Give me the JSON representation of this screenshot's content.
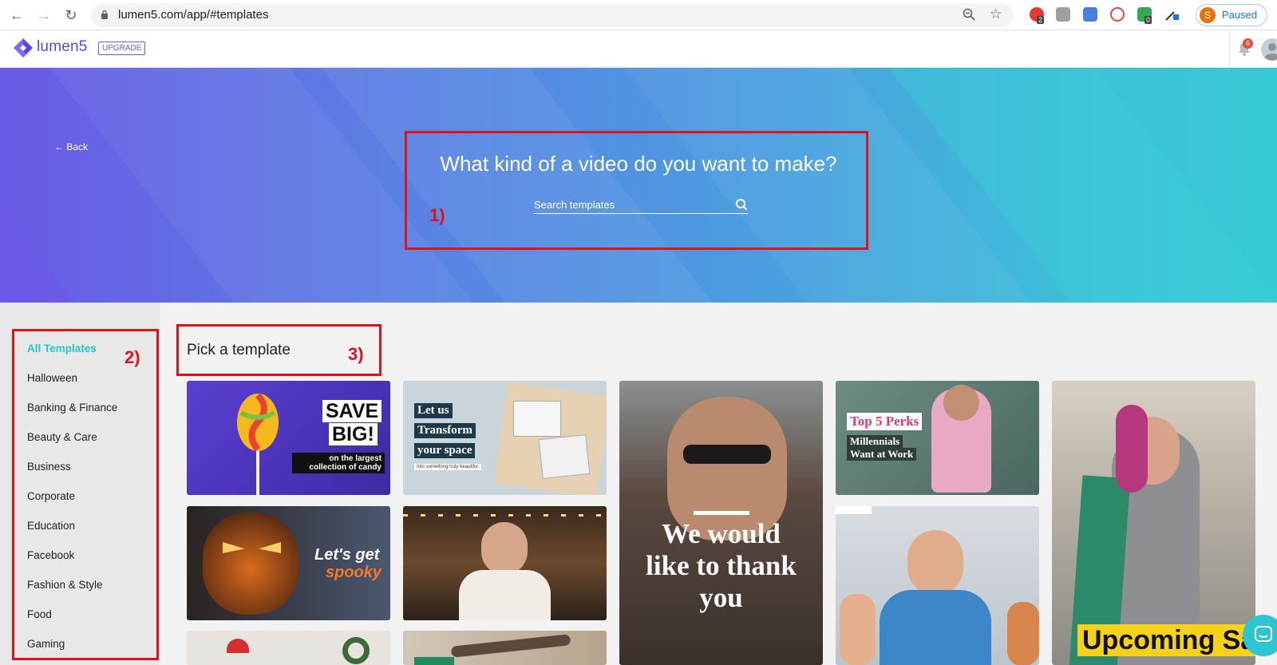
{
  "browser": {
    "url": "lumen5.com/app/#templates",
    "profile_initial": "S",
    "profile_label": "Paused",
    "ext_badges": [
      "2",
      "0"
    ]
  },
  "app": {
    "logo_text": "lumen5",
    "upgrade_label": "UPGRADE",
    "notification_count": "6"
  },
  "hero": {
    "back_label": "← Back",
    "title": "What kind of a video do you want to make?",
    "search_placeholder": "Search templates"
  },
  "annotations": [
    "1)",
    "2)",
    "3)"
  ],
  "sidebar": {
    "categories": [
      "All Templates",
      "Halloween",
      "Banking & Finance",
      "Beauty & Care",
      "Business",
      "Corporate",
      "Education",
      "Facebook",
      "Fashion & Style",
      "Food",
      "Gaming"
    ]
  },
  "main": {
    "heading": "Pick a template",
    "templates": [
      {
        "title_line1": "SAVE",
        "title_line2": "BIG!",
        "subtitle": "on the largest collection of candy"
      },
      {
        "line1": "Let us",
        "line2": "Transform",
        "line3": "your space",
        "caption": "Into something truly beautiful."
      },
      {
        "text": "We would like to thank you"
      },
      {
        "headline": "Top 5 Perks",
        "sub1": "Millennials",
        "sub2": "Want at Work"
      },
      {
        "text": "Upcoming Sale"
      },
      {
        "line1": "Let's get",
        "line2": "spooky"
      },
      {
        "text": ""
      },
      {
        "text": ""
      },
      {
        "text": ""
      },
      {
        "text": ""
      }
    ]
  },
  "colors": {
    "brand": "#5b47e0",
    "accent": "#22c3d6",
    "annotation": "#e0131c"
  }
}
